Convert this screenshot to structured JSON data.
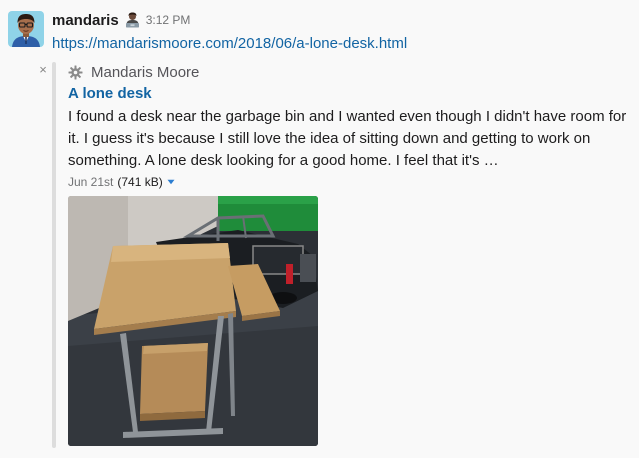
{
  "message": {
    "username": "mandaris",
    "timestamp": "3:12 PM",
    "link_url": "https://mandarismoore.com/2018/06/a-lone-desk.html",
    "avatar_icon": "avatar-man-glasses-icon",
    "status_icon": "technologist-emoji-icon"
  },
  "attachment": {
    "close_glyph": "×",
    "author_icon": "gear-icon",
    "author_name": "Mandaris Moore",
    "title": "A lone desk",
    "text": "I found a desk near the garbage bin and I wanted even though I didn't have room for it. I guess it's because I still love the idea of sitting down and getting to work on something. A lone desk looking for a good home. I feel that it's …",
    "file_date": "Jun 21st",
    "file_size": "(741 kB)",
    "caret_icon": "caret-down-icon"
  },
  "colors": {
    "link": "#1264a3",
    "bar": "#dddddd",
    "caret": "#2d7ed1"
  }
}
